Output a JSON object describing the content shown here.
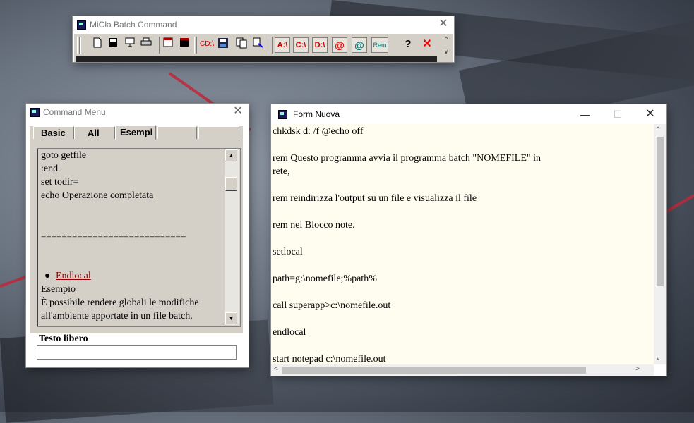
{
  "batch_window": {
    "title": "MiCla Batch Command",
    "toolbar": {
      "cd_label": "CD:\\",
      "drive_a": "A:\\",
      "drive_c": "C:\\",
      "drive_d": "D:\\",
      "at_red": "@",
      "at_teal": "@",
      "rem_label": "Rem",
      "help_label": "?",
      "close_label": "✕"
    }
  },
  "command_menu": {
    "title": "Command Menu",
    "tabs": [
      "Basic",
      "All",
      "Esempi",
      "",
      ""
    ],
    "active_tab": "Esempi",
    "lines": [
      "goto getfile",
      ":end",
      "set todir=",
      "echo Operazione completata",
      "============================"
    ],
    "link_text": "Endlocal",
    "after_lines": [
      "Esempio",
      "È possibile rendere globali le modifiche",
      "all'ambiente apportate in un file batch."
    ],
    "free_text_label": "Testo libero",
    "free_text_value": ""
  },
  "form_nuova": {
    "title": "Form Nuova",
    "lines": [
      "chkdsk d: /f @echo off",
      "",
      "rem Questo programma avvia il programma batch \"NOMEFILE\" in",
      "rete,",
      "",
      "rem reindirizza l'output su un file e visualizza il file",
      "",
      "rem nel Blocco note.",
      "",
      "setlocal",
      "",
      "path=g:\\nomefile;%path%",
      "",
      "call superapp>c:\\nomefile.out",
      "",
      "endlocal",
      "",
      "start notepad c:\\nomefile.out"
    ]
  }
}
